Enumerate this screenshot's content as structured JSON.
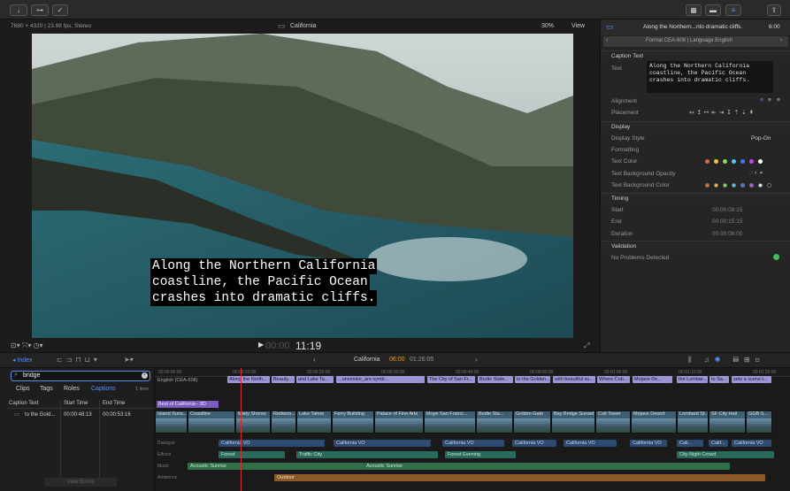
{
  "toolbar": {
    "btn_import": "↓",
    "btn_keywords": "⊶",
    "btn_check": "✓"
  },
  "viewer": {
    "info": "7680 × 4320 | 23.98 fps, Stereo",
    "title": "California",
    "zoom": "30%",
    "view": "View",
    "caption_lines": [
      "Along the Northern California",
      "coastline, the Pacific Ocean",
      "crashes into dramatic cliffs."
    ],
    "timecode": "11:19",
    "timecode_dim": "00:00"
  },
  "inspector": {
    "header_title": "Along the Northern...nto dramatic cliffs.",
    "header_time": "6:00",
    "format": "Format CEA-608 | Language English",
    "section_caption": "Caption Text",
    "text_label": "Text",
    "text_value": "Along the Northern California coastline, the Pacific Ocean crashes into dramatic cliffs.",
    "alignment": "Alignment",
    "placement": "Placement",
    "section_display": "Display",
    "display_style": "Display Style",
    "display_style_value": "Pop-On",
    "formatting": "Formatting",
    "text_color": "Text Color",
    "text_bg_opacity": "Text Background Opacity",
    "text_bg_color": "Text Background Color",
    "section_timing": "Timing",
    "start": "Start",
    "start_value": "00:00:09:15",
    "end": "End",
    "end_value": "00:00:15:15",
    "duration": "Duration",
    "duration_value": "00:00:06:00",
    "section_validation": "Validation",
    "validation_value": "No Problems Detected",
    "text_colors": [
      "#e8623a",
      "#f2c53a",
      "#8ee04c",
      "#4dd0e1",
      "#3f7bf5",
      "#c04de8",
      "#ffffff"
    ],
    "bg_colors": [
      "#e8623a",
      "#f2c53a",
      "#8ee04c",
      "#4dd0e1",
      "#3f7bf5",
      "#c04de8",
      "#ffffff",
      "#111111"
    ]
  },
  "timeline_bar": {
    "index": "Index",
    "project": "California",
    "time": "06:00",
    "duration": "01:26:05"
  },
  "index": {
    "search_value": "bridge",
    "tabs": [
      "Clips",
      "Tags",
      "Roles",
      "Captions"
    ],
    "count": "1 item",
    "columns": [
      "Caption Text",
      "Start Time",
      "End Time"
    ],
    "rows": [
      {
        "text": "to the Gold...",
        "start": "00:00:48:13",
        "end": "00:00:53:16"
      }
    ],
    "view_errors": "View Errors"
  },
  "timeline": {
    "ruler": [
      "00:00:00:00",
      "00:00:10:00",
      "00:00:20:00",
      "00:00:30:00",
      "00:00:40:00",
      "00:00:50:00",
      "00:01:00:00",
      "00:01:10:00",
      "00:01:20:00"
    ],
    "caption_role": "English (CEA-608)",
    "titles_clip": "Best of California - 3D",
    "captions": [
      "Along the North...",
      "Beauty...",
      "and Lake Ta...",
      "...unsmoke_are symb...",
      "The City of San Fr...",
      "Bodie State...",
      "to the Golden...",
      "with beautiful su...",
      "Where Cob...",
      "Mojave De...",
      "the Lombar...",
      "to Sa...",
      "sets a scene t..."
    ],
    "clips": [
      "Island Suns...",
      "Coastline",
      "Misty Shores",
      "Redwoo...",
      "Lake Tahoe",
      "Ferry Building",
      "Palace of Fine Arts",
      "Muye San Franci...",
      "Bodie Sta...",
      "Golden Gate",
      "Bay Bridge Sunset",
      "Coit Tower",
      "Mojave Desert",
      "Lombard St...",
      "SF City Hall",
      "GGB S..."
    ],
    "lanes": [
      "Dialogue",
      "Effects",
      "Music",
      "Ambience"
    ],
    "dialogue": [
      "California VO",
      "California VO",
      "California VO",
      "California VO",
      "California VO",
      "California VO",
      "Cali...",
      "Calif...",
      "California VO"
    ],
    "effects": [
      "Forest",
      "Traffic City",
      "Forest Evening",
      "City Night Crowd"
    ],
    "music": [
      "Acoustic Sunrise",
      "Acoustic Sunrise"
    ],
    "ambience": [
      "Outdoor"
    ]
  },
  "colors": {
    "caption_lane": "#9b95d6",
    "video_clip": "#3d5f73",
    "dialogue": "#2d4a70",
    "effects": "#2a6a5c",
    "music": "#2f6e47",
    "ambience": "#8a5a2a",
    "playhead": "#d03030",
    "accent": "#5b8ef0"
  }
}
